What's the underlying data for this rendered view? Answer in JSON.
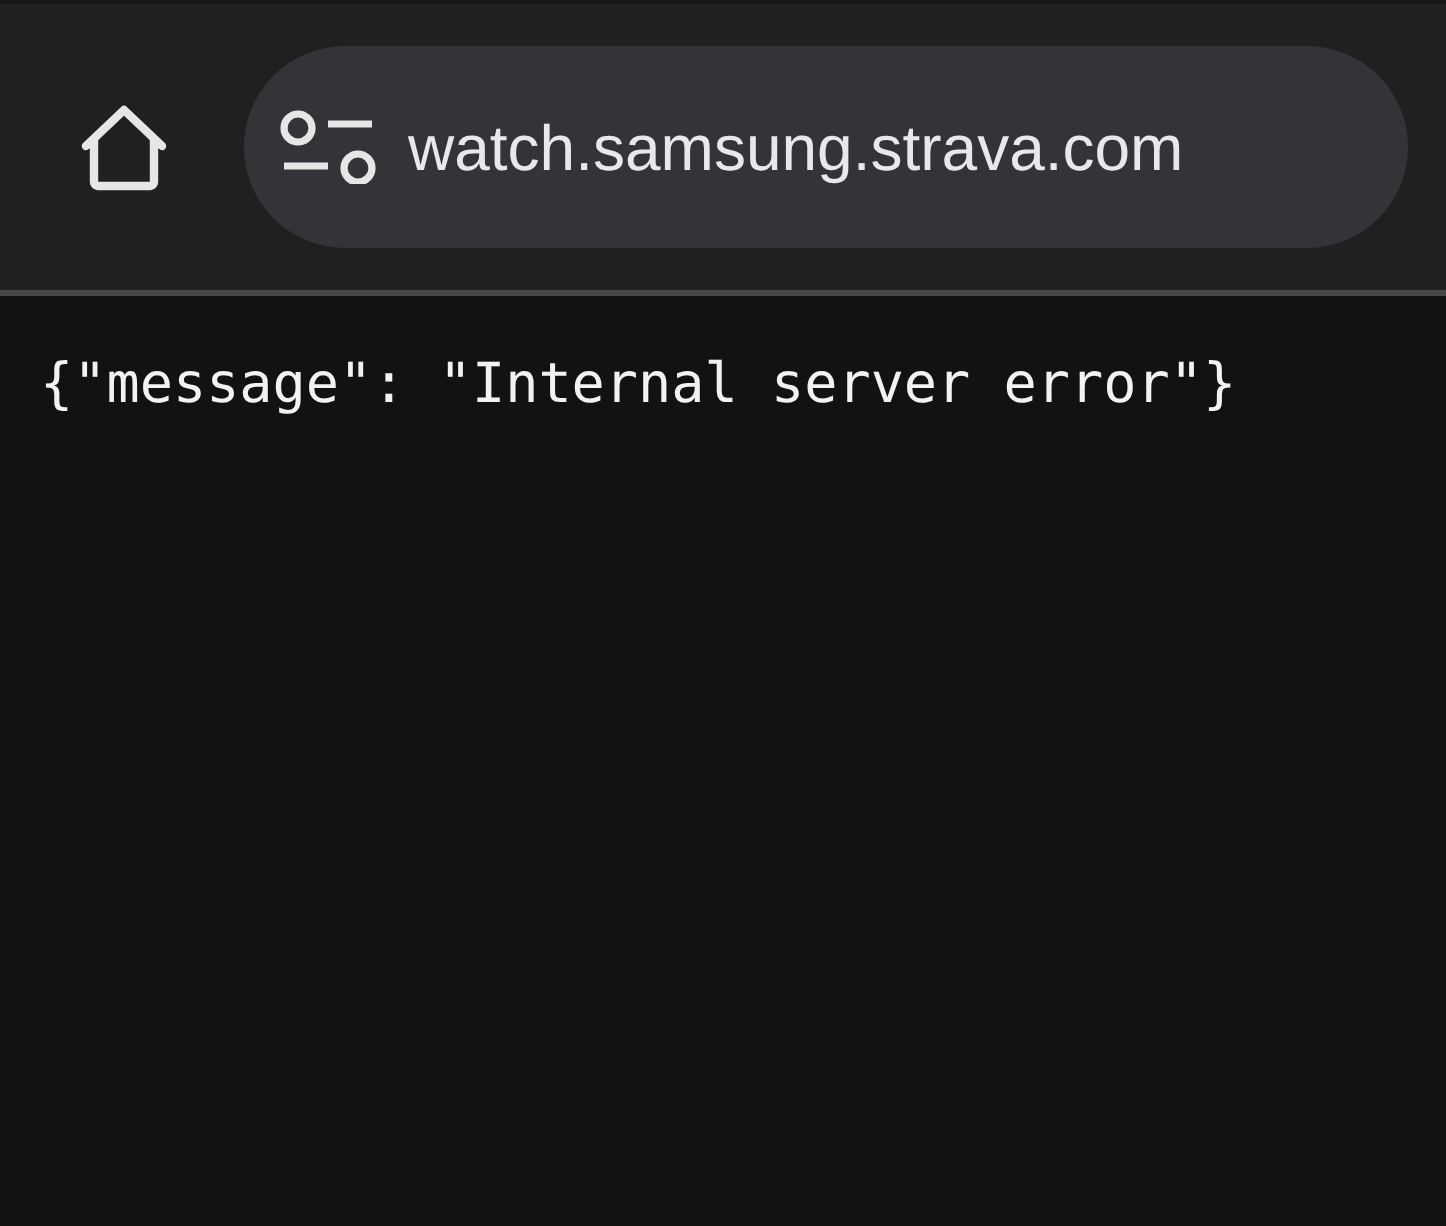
{
  "toolbar": {
    "url": "watch.samsung.strava.com"
  },
  "page": {
    "text": "{\"message\": \"Internal server error\"}"
  }
}
